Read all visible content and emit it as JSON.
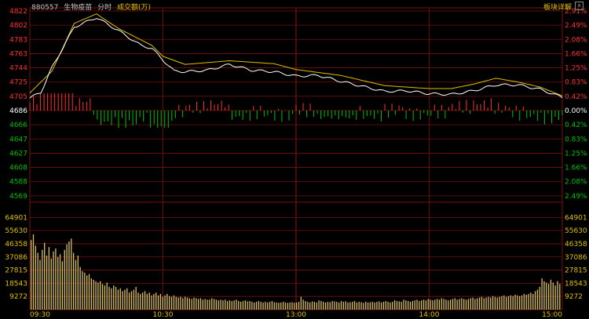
{
  "header": {
    "code": "880557",
    "name": "生物疫苗",
    "mode": "分时",
    "metric": "成交额(万)",
    "detail_link": "板块详解",
    "close_label": "x"
  },
  "colors": {
    "background": "#000000",
    "grid": "#7a1010",
    "up": "#ff3030",
    "down": "#00c000",
    "price_line": "#ffffff",
    "avg_line": "#e0c000",
    "volume": "#d8c060",
    "base_label": "#ffffff"
  },
  "chart_data": [
    {
      "type": "line",
      "title": "",
      "x_labels": [
        "09:30",
        "10:30",
        "13:00",
        "14:00",
        "15:00"
      ],
      "base_price": 4686,
      "price_ticks": [
        4822,
        4802,
        4783,
        4763,
        4744,
        4725,
        4705,
        4686,
        4666,
        4647,
        4627,
        4608,
        4588,
        4569
      ],
      "pct_ticks": [
        "2.91%",
        "2.49%",
        "2.08%",
        "1.66%",
        "1.25%",
        "0.83%",
        "0.42%",
        "0.00%",
        "0.42%",
        "0.83%",
        "1.25%",
        "1.66%",
        "2.08%",
        "2.49%"
      ],
      "ylim": [
        4569,
        4822
      ],
      "series": [
        {
          "key": "price",
          "x": [
            0,
            5,
            10,
            15,
            20,
            30,
            40,
            50,
            55,
            60,
            65,
            70,
            80,
            90,
            100,
            110,
            120,
            130,
            140,
            150,
            160,
            170,
            180,
            190,
            200,
            210,
            220,
            230,
            240
          ],
          "values": [
            4703,
            4711,
            4745,
            4772,
            4800,
            4813,
            4795,
            4775,
            4771,
            4755,
            4740,
            4739,
            4741,
            4749,
            4741,
            4739,
            4733,
            4734,
            4726,
            4719,
            4712,
            4713,
            4709,
            4708,
            4713,
            4721,
            4721,
            4715,
            4704
          ]
        },
        {
          "key": "average",
          "x": [
            0,
            10,
            20,
            30,
            40,
            55,
            60,
            70,
            90,
            110,
            120,
            140,
            160,
            180,
            190,
            200,
            210,
            220,
            230,
            240
          ],
          "values": [
            4710,
            4740,
            4805,
            4818,
            4798,
            4775,
            4760,
            4749,
            4754,
            4750,
            4742,
            4734,
            4720,
            4716,
            4716,
            4722,
            4730,
            4725,
            4718,
            4706
          ]
        }
      ]
    },
    {
      "type": "bar",
      "title": "",
      "x_labels": [
        "09:30",
        "10:30",
        "13:00",
        "14:00",
        "15:00"
      ],
      "ylabel": "成交额(万)",
      "yticks": [
        64901,
        55630,
        46358,
        37086,
        27815,
        18543,
        9272
      ],
      "ylim": [
        0,
        69500
      ],
      "values": [
        49000,
        53000,
        45000,
        40000,
        35000,
        42000,
        47000,
        38000,
        44000,
        36000,
        41000,
        43000,
        37000,
        39000,
        34000,
        42000,
        46000,
        48000,
        50000,
        40000,
        35000,
        38000,
        30000,
        27000,
        26000,
        24000,
        25000,
        22000,
        21000,
        20000,
        19000,
        20000,
        18000,
        17000,
        19000,
        16000,
        15000,
        17000,
        16000,
        14000,
        15000,
        13000,
        14000,
        15000,
        12000,
        13000,
        14000,
        16000,
        12000,
        11000,
        12000,
        13000,
        11000,
        12000,
        10000,
        11000,
        12000,
        10000,
        11000,
        9000,
        10000,
        11000,
        9500,
        9000,
        10000,
        9000,
        8500,
        9000,
        8000,
        9000,
        8500,
        8000,
        7500,
        8500,
        8000,
        7500,
        8000,
        7000,
        7500,
        7000,
        7000,
        8000,
        7500,
        7000,
        6500,
        7000,
        6500,
        7000,
        6000,
        6500,
        6000,
        6500,
        7000,
        6000,
        5500,
        6000,
        6500,
        5800,
        6000,
        5500,
        5000,
        5500,
        6000,
        5500,
        5000,
        5500,
        5000,
        5500,
        6000,
        5200,
        5000,
        4800,
        5000,
        5500,
        5000,
        4800,
        5000,
        5200,
        4800,
        5000,
        5500,
        9000,
        7000,
        6000,
        5500,
        5000,
        5800,
        5500,
        5000,
        6500,
        6000,
        5500,
        5000,
        5500,
        5200,
        6000,
        5800,
        5500,
        5000,
        6000,
        5500,
        5800,
        5000,
        5200,
        5500,
        6000,
        5000,
        5500,
        5200,
        4800,
        5500,
        5000,
        5200,
        5500,
        5000,
        5500,
        5800,
        5000,
        5500,
        6000,
        5500,
        5000,
        5500,
        6500,
        6000,
        5800,
        5500,
        7000,
        6500,
        6000,
        5500,
        6000,
        6500,
        7000,
        6000,
        6500,
        7000,
        6500,
        7500,
        7000,
        6500,
        7000,
        7500,
        7000,
        8000,
        7500,
        7000,
        6500,
        7000,
        7500,
        8000,
        7000,
        7500,
        8000,
        7500,
        7000,
        7500,
        8000,
        8500,
        7500,
        8000,
        8500,
        9000,
        8000,
        8500,
        9000,
        8500,
        9500,
        9000,
        8500,
        9000,
        9500,
        10000,
        9000,
        9500,
        10000,
        9500,
        10500,
        10000,
        9500,
        10000,
        11000,
        10500,
        11000,
        12000,
        11000,
        13000,
        14000,
        16000,
        22000,
        20000,
        19000,
        18000,
        21000,
        19000,
        17000,
        20000,
        18000
      ]
    }
  ]
}
